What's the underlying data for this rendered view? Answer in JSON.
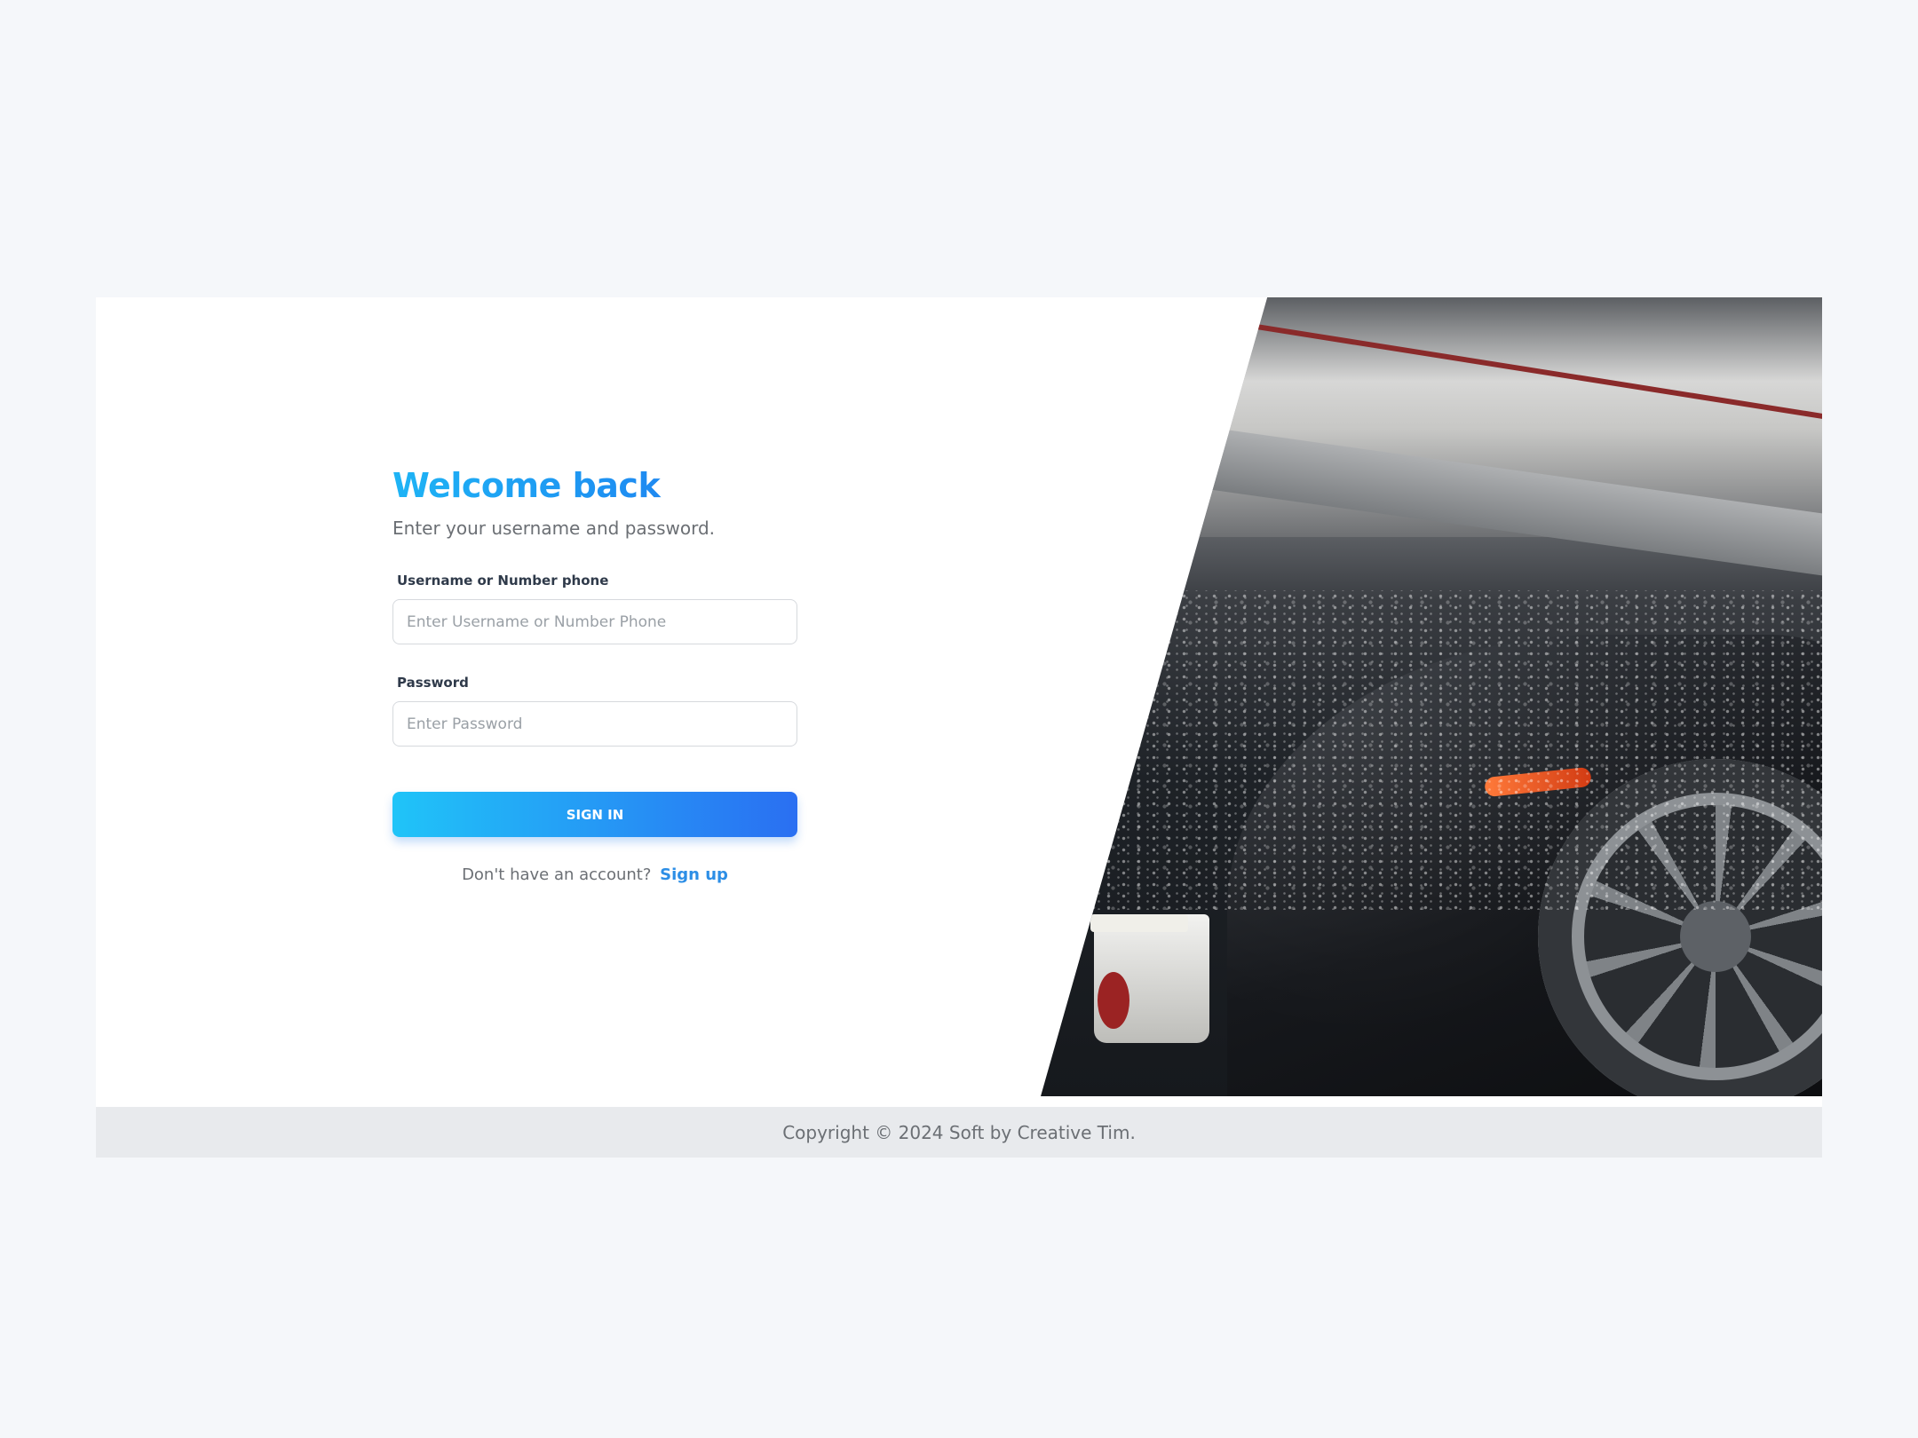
{
  "login": {
    "title": "Welcome back",
    "subtitle": "Enter your username and password.",
    "username_label": "Username or Number phone",
    "username_placeholder": "Enter Username or Number Phone",
    "password_label": "Password",
    "password_placeholder": "Enter Password",
    "signin_label": "SIGN IN",
    "signup_prompt": "Don't have an account?",
    "signup_link": "Sign up"
  },
  "footer": {
    "copyright": "Copyright © 2024 Soft by Creative Tim."
  },
  "colors": {
    "page_background": "#f5f7fa",
    "title_gradient_start": "#1eb4f5",
    "title_gradient_end": "#1f74ef",
    "button_gradient_start": "#20c4f8",
    "button_gradient_end": "#2a6ff2",
    "link": "#2c8ee6",
    "footer_background": "#e8eaed"
  }
}
